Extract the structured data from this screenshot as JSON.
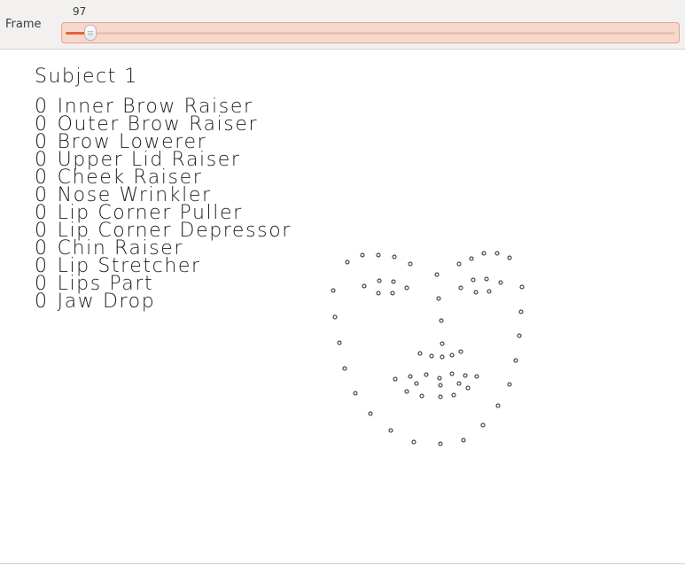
{
  "toolbar": {
    "frame_label": "Frame",
    "frame_value": "97",
    "slider_fraction": 0.03
  },
  "main": {
    "subject_title": "Subject 1",
    "action_units": [
      {
        "value": "0",
        "name": "Inner Brow Raiser"
      },
      {
        "value": "0",
        "name": "Outer Brow Raiser"
      },
      {
        "value": "0",
        "name": "Brow Lowerer"
      },
      {
        "value": "0",
        "name": "Upper Lid Raiser"
      },
      {
        "value": "0",
        "name": "Cheek Raiser"
      },
      {
        "value": "0",
        "name": "Nose Wrinkler"
      },
      {
        "value": "0",
        "name": "Lip Corner Puller"
      },
      {
        "value": "0",
        "name": "Lip Corner Depressor"
      },
      {
        "value": "0",
        "name": "Chin Raiser"
      },
      {
        "value": "0",
        "name": "Lip Stretcher"
      },
      {
        "value": "0",
        "name": "Lips Part"
      },
      {
        "value": "0",
        "name": "Jaw Drop"
      }
    ]
  },
  "colors": {
    "accent": "#e1633a",
    "slider_bg": "#f8d8cc",
    "landmark_stroke": "#222222"
  }
}
